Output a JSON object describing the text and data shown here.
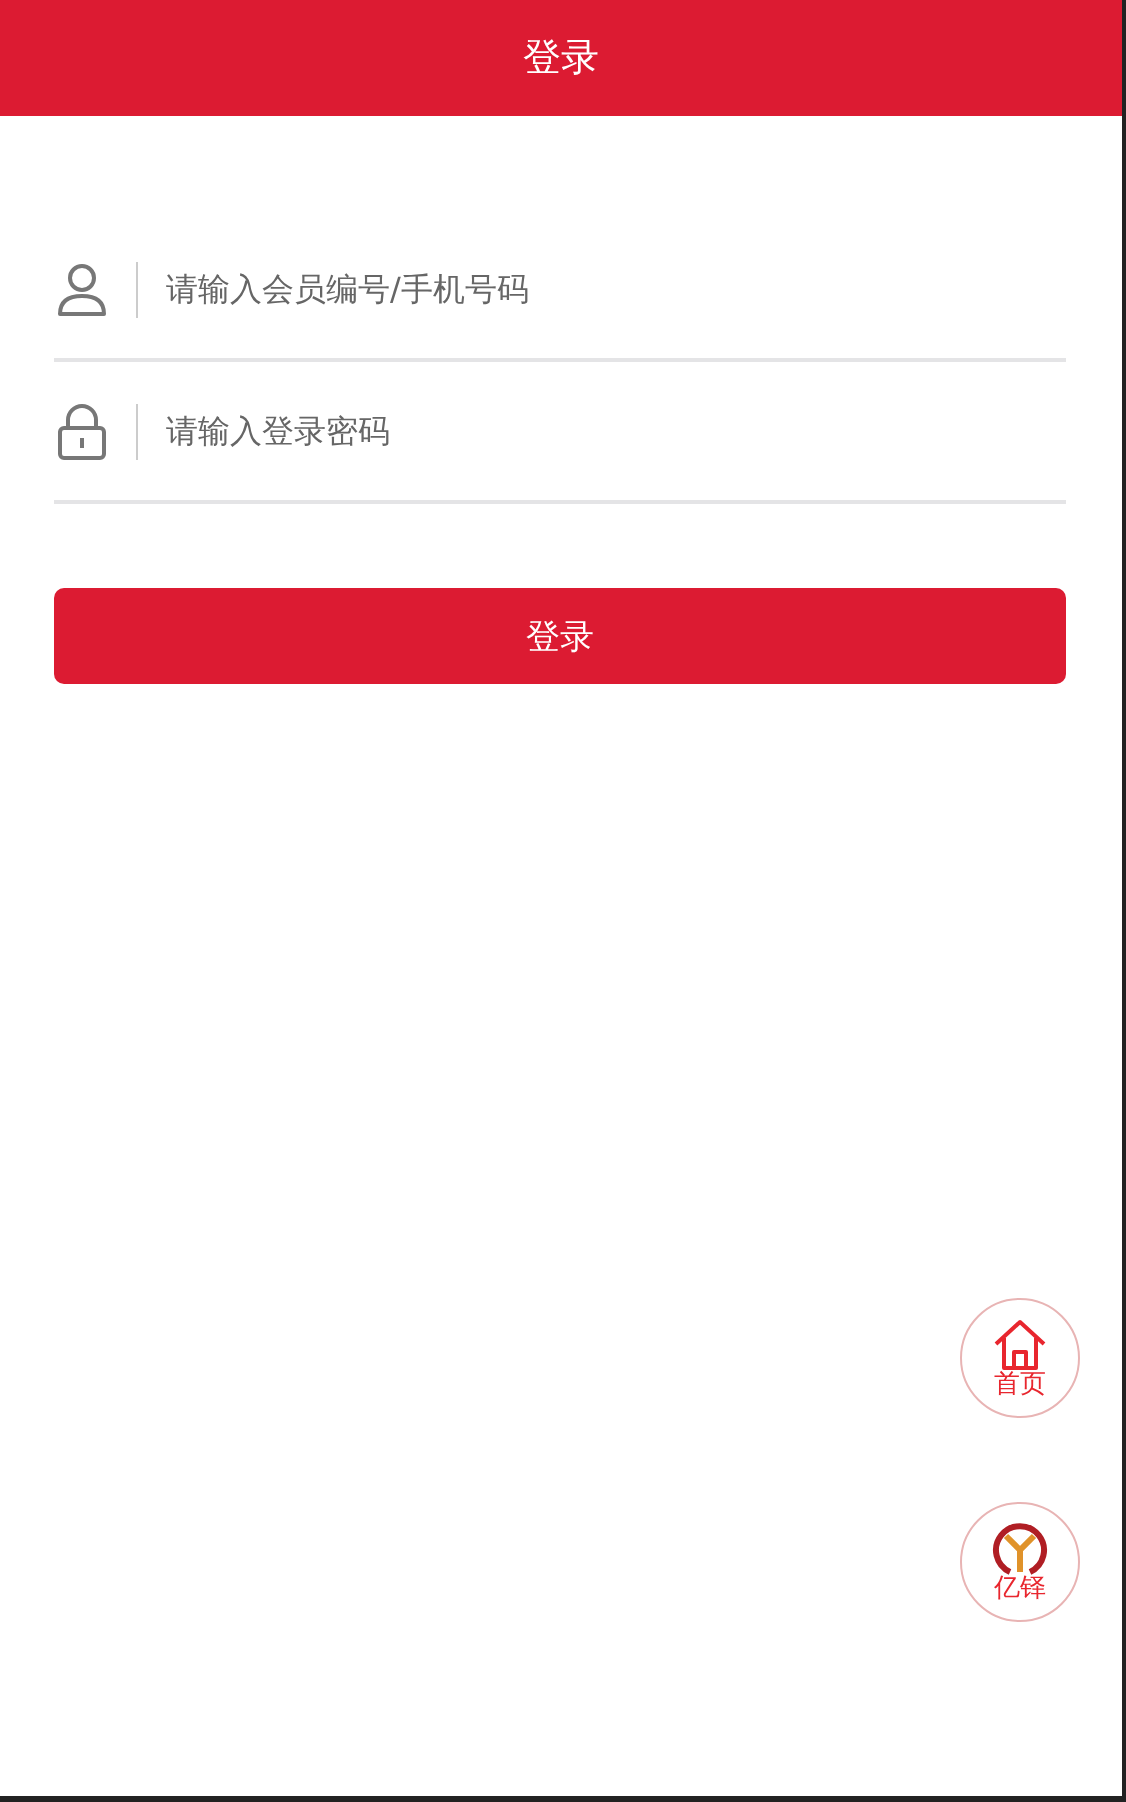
{
  "header": {
    "title": "登录"
  },
  "fields": [
    {
      "kind": "user",
      "placeholder": "请输入会员编号/手机号码"
    },
    {
      "kind": "password",
      "placeholder": "请输入登录密码"
    }
  ],
  "login_button": "登录",
  "float_buttons": [
    {
      "kind": "home",
      "label": "首页"
    },
    {
      "kind": "logo",
      "label": "亿铎"
    }
  ]
}
